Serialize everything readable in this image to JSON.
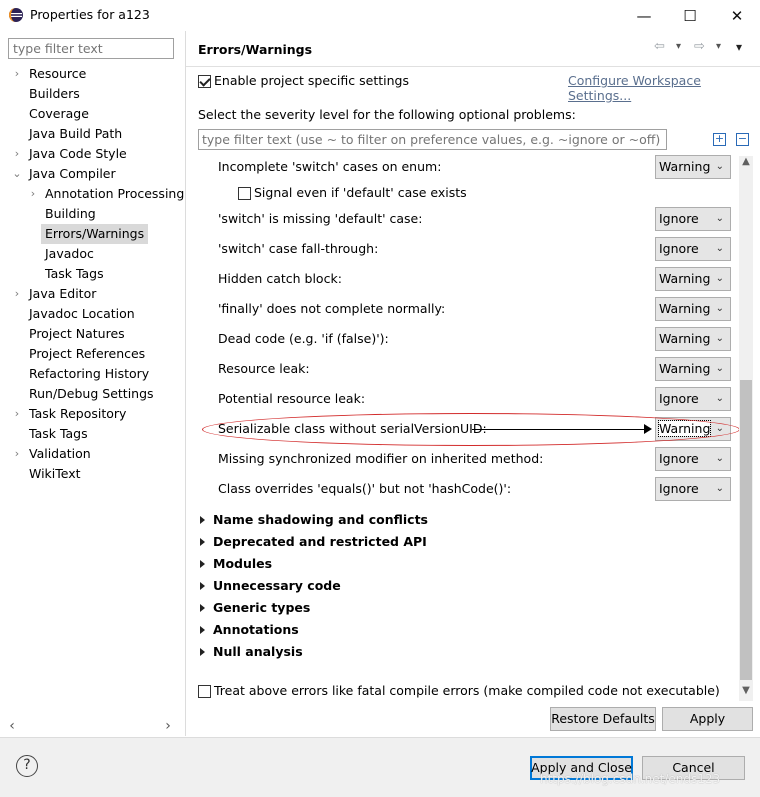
{
  "window": {
    "title": "Properties for a123",
    "minimize_glyph": "—",
    "maximize_glyph": "☐",
    "close_glyph": "✕"
  },
  "left": {
    "filter_placeholder": "type filter text",
    "selected": "Errors/Warnings",
    "items": [
      {
        "label": "Resource",
        "level": 0,
        "arrow": "›"
      },
      {
        "label": "Builders",
        "level": 0,
        "arrow": ""
      },
      {
        "label": "Coverage",
        "level": 0,
        "arrow": ""
      },
      {
        "label": "Java Build Path",
        "level": 0,
        "arrow": ""
      },
      {
        "label": "Java Code Style",
        "level": 0,
        "arrow": "›"
      },
      {
        "label": "Java Compiler",
        "level": 0,
        "arrow": "⌄"
      },
      {
        "label": "Annotation Processing",
        "level": 1,
        "arrow": "›"
      },
      {
        "label": "Building",
        "level": 1,
        "arrow": ""
      },
      {
        "label": "Errors/Warnings",
        "level": 1,
        "arrow": ""
      },
      {
        "label": "Javadoc",
        "level": 1,
        "arrow": ""
      },
      {
        "label": "Task Tags",
        "level": 1,
        "arrow": ""
      },
      {
        "label": "Java Editor",
        "level": 0,
        "arrow": "›"
      },
      {
        "label": "Javadoc Location",
        "level": 0,
        "arrow": ""
      },
      {
        "label": "Project Natures",
        "level": 0,
        "arrow": ""
      },
      {
        "label": "Project References",
        "level": 0,
        "arrow": ""
      },
      {
        "label": "Refactoring History",
        "level": 0,
        "arrow": ""
      },
      {
        "label": "Run/Debug Settings",
        "level": 0,
        "arrow": ""
      },
      {
        "label": "Task Repository",
        "level": 0,
        "arrow": "›"
      },
      {
        "label": "Task Tags",
        "level": 0,
        "arrow": ""
      },
      {
        "label": "Validation",
        "level": 0,
        "arrow": "›"
      },
      {
        "label": "WikiText",
        "level": 0,
        "arrow": ""
      }
    ],
    "scroll_left": "‹",
    "scroll_right": "›"
  },
  "pane": {
    "title": "Errors/Warnings",
    "nav_back": "⇦",
    "nav_back_menu": "▾",
    "nav_forward": "⇨",
    "nav_forward_menu": "▾",
    "view_menu": "▾",
    "enable_specific": "Enable project specific settings",
    "enable_checked": true,
    "configure_link": "Configure Workspace Settings...",
    "severity_label": "Select the severity level for the following optional problems:",
    "filter_placeholder": "type filter text (use ~ to filter on preference values, e.g. ~ignore or ~off)",
    "expand_glyph": "+",
    "collapse_glyph": "−",
    "signal_label": "Signal even if 'default' case exists",
    "options": [
      {
        "label": "Incomplete 'switch' cases on enum:",
        "value": "Warning"
      },
      {
        "label": "'switch' is missing 'default' case:",
        "value": "Ignore"
      },
      {
        "label": "'switch' case fall-through:",
        "value": "Ignore"
      },
      {
        "label": "Hidden catch block:",
        "value": "Warning"
      },
      {
        "label": "'finally' does not complete normally:",
        "value": "Warning"
      },
      {
        "label": "Dead code (e.g. 'if (false)'):",
        "value": "Warning"
      },
      {
        "label": "Resource leak:",
        "value": "Warning"
      },
      {
        "label": "Potential resource leak:",
        "value": "Ignore"
      },
      {
        "label": "Serializable class without serialVersionUID:",
        "value": "Warning"
      },
      {
        "label": "Missing synchronized modifier on inherited method:",
        "value": "Ignore"
      },
      {
        "label": "Class overrides 'equals()' but not 'hashCode()':",
        "value": "Ignore"
      }
    ],
    "chevron": "⌄",
    "sections": [
      "Name shadowing and conflicts",
      "Deprecated and restricted API",
      "Modules",
      "Unnecessary code",
      "Generic types",
      "Annotations",
      "Null analysis"
    ],
    "scroll_up": "▲",
    "scroll_down": "▼",
    "treat_label": "Treat above errors like fatal compile errors (make compiled code not executable)",
    "restore_defaults": "Restore Defaults",
    "apply": "Apply"
  },
  "bottom": {
    "help_glyph": "?",
    "apply_and_close": "Apply and Close",
    "cancel": "Cancel",
    "watermark": "https://blog.csdn.net/ends123"
  }
}
